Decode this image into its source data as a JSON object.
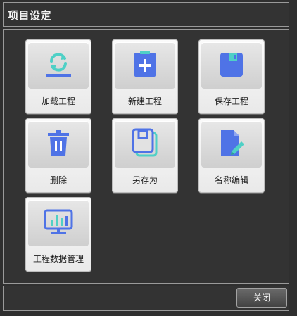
{
  "window": {
    "title": "项目设定"
  },
  "tiles": [
    {
      "label": "加载工程",
      "icon": "load-project-icon"
    },
    {
      "label": "新建工程",
      "icon": "new-project-icon"
    },
    {
      "label": "保存工程",
      "icon": "save-project-icon"
    },
    {
      "label": "删除",
      "icon": "delete-icon"
    },
    {
      "label": "另存为",
      "icon": "save-as-icon"
    },
    {
      "label": "名称编辑",
      "icon": "rename-icon"
    },
    {
      "label": "工程数据管理",
      "icon": "data-management-icon"
    }
  ],
  "footer": {
    "close_label": "关闭"
  },
  "colors": {
    "icon_blue": "#4f73e6",
    "icon_teal": "#4fd0c6"
  }
}
